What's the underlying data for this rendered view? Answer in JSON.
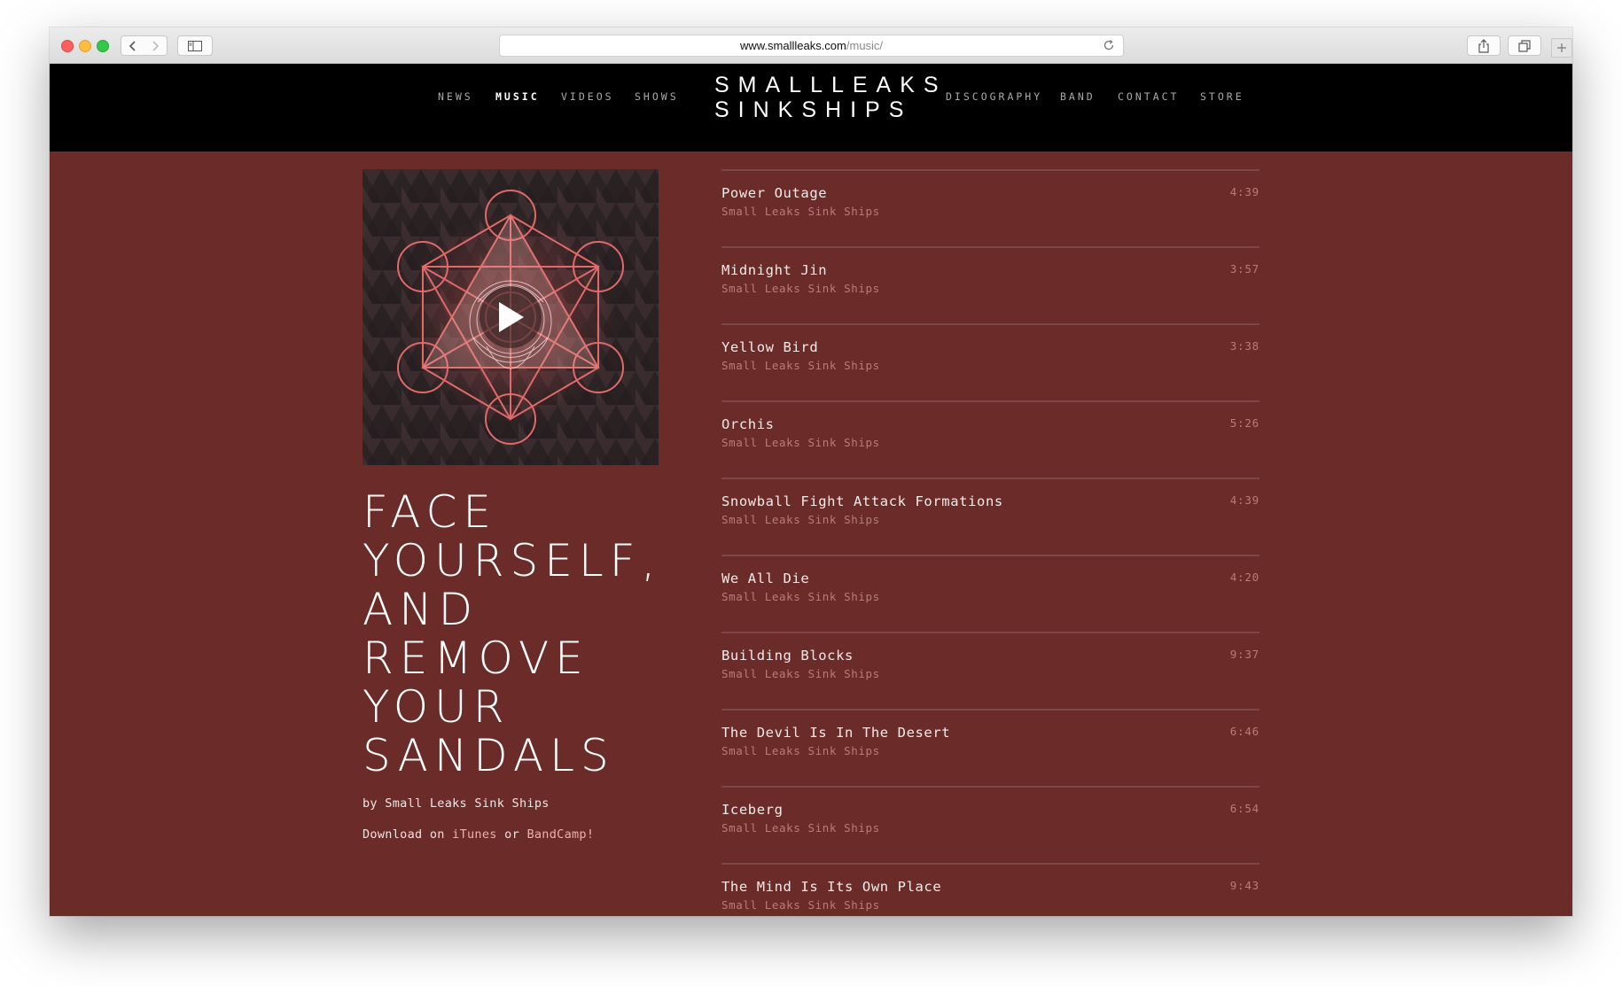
{
  "browser": {
    "url_host": "www.smallleaks.com",
    "url_path": "/music/"
  },
  "nav": {
    "left": [
      {
        "label": "NEWS",
        "active": false
      },
      {
        "label": "MUSIC",
        "active": true
      },
      {
        "label": "VIDEOS",
        "active": false
      },
      {
        "label": "SHOWS",
        "active": false
      }
    ],
    "logo_line1": "SMALLLEAKS",
    "logo_line2": "SINKSHIPS",
    "right": [
      {
        "label": "DISCOGRAPHY",
        "active": false
      },
      {
        "label": "BAND",
        "active": false
      },
      {
        "label": "CONTACT",
        "active": false
      },
      {
        "label": "STORE",
        "active": false
      }
    ]
  },
  "album": {
    "title": "FACE YOURSELF, AND REMOVE YOUR SANDALS",
    "byline": "by Small Leaks Sink Ships",
    "download_prefix": "Download on ",
    "download_itunes": "iTunes",
    "download_or": " or ",
    "download_bandcamp": "BandCamp!",
    "cover_icon": "play-icon"
  },
  "tracks": [
    {
      "name": "Power Outage",
      "artist": "Small Leaks Sink Ships",
      "duration": "4:39"
    },
    {
      "name": "Midnight Jin",
      "artist": "Small Leaks Sink Ships",
      "duration": "3:57"
    },
    {
      "name": "Yellow Bird",
      "artist": "Small Leaks Sink Ships",
      "duration": "3:38"
    },
    {
      "name": "Orchis",
      "artist": "Small Leaks Sink Ships",
      "duration": "5:26"
    },
    {
      "name": "Snowball Fight Attack Formations",
      "artist": "Small Leaks Sink Ships",
      "duration": "4:39"
    },
    {
      "name": "We All Die",
      "artist": "Small Leaks Sink Ships",
      "duration": "4:20"
    },
    {
      "name": "Building Blocks",
      "artist": "Small Leaks Sink Ships",
      "duration": "9:37"
    },
    {
      "name": "The Devil Is In The Desert",
      "artist": "Small Leaks Sink Ships",
      "duration": "6:46"
    },
    {
      "name": "Iceberg",
      "artist": "Small Leaks Sink Ships",
      "duration": "6:54"
    },
    {
      "name": "The Mind Is Its Own Place",
      "artist": "Small Leaks Sink Ships",
      "duration": "9:43"
    }
  ],
  "colors": {
    "page_background": "#6b2b29",
    "header_background": "#000000",
    "muted_text": "#b77d79",
    "link_accent": "#e9b2ae"
  }
}
